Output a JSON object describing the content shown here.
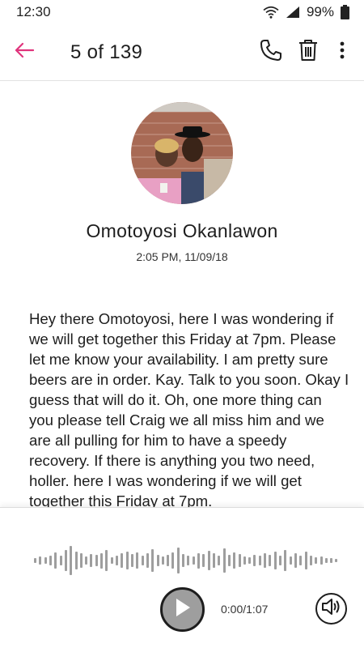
{
  "status_bar": {
    "time": "12:30",
    "battery": "99%",
    "icons": [
      "wifi-icon",
      "signal-icon",
      "battery-icon"
    ]
  },
  "app_bar": {
    "title": "5 of 139",
    "back_icon": "arrow-left-icon",
    "actions": [
      "phone-icon",
      "trash-icon",
      "more-vert-icon"
    ],
    "accent_color": "#e0347c"
  },
  "contact": {
    "name": "Omotoyosi Okanlawon",
    "timestamp": "2:05 PM, 11/09/18"
  },
  "message": {
    "transcript": "Hey there Omotoyosi, here I was wondering if we will get together this Friday at 7pm. Please let me know your availability.  I am pretty sure beers are in order.  Kay.  Talk to you soon.  Okay I guess that will do it.  Oh, one more thing can you please tell Craig we all miss him and we are all pulling for him to have a speedy recovery.  If there is anything you two need, holler. here I was wondering if we will get together this Friday at 7pm."
  },
  "player": {
    "position": "0:00",
    "duration": "1:07",
    "elapsed_display": "0:00/1:07",
    "play_icon": "play-icon",
    "speaker_icon": "speaker-icon",
    "waveform_color": "#9e9e9e",
    "waveform_levels": [
      0.14,
      0.24,
      0.2,
      0.3,
      0.55,
      0.34,
      0.7,
      0.95,
      0.6,
      0.45,
      0.28,
      0.4,
      0.36,
      0.5,
      0.7,
      0.22,
      0.3,
      0.48,
      0.6,
      0.4,
      0.55,
      0.3,
      0.45,
      0.75,
      0.38,
      0.28,
      0.36,
      0.55,
      0.85,
      0.42,
      0.3,
      0.25,
      0.5,
      0.4,
      0.62,
      0.45,
      0.3,
      0.8,
      0.35,
      0.55,
      0.42,
      0.28,
      0.22,
      0.35,
      0.3,
      0.48,
      0.38,
      0.58,
      0.3,
      0.7,
      0.26,
      0.48,
      0.34,
      0.6,
      0.34,
      0.2,
      0.26,
      0.18,
      0.14,
      0.1
    ]
  }
}
